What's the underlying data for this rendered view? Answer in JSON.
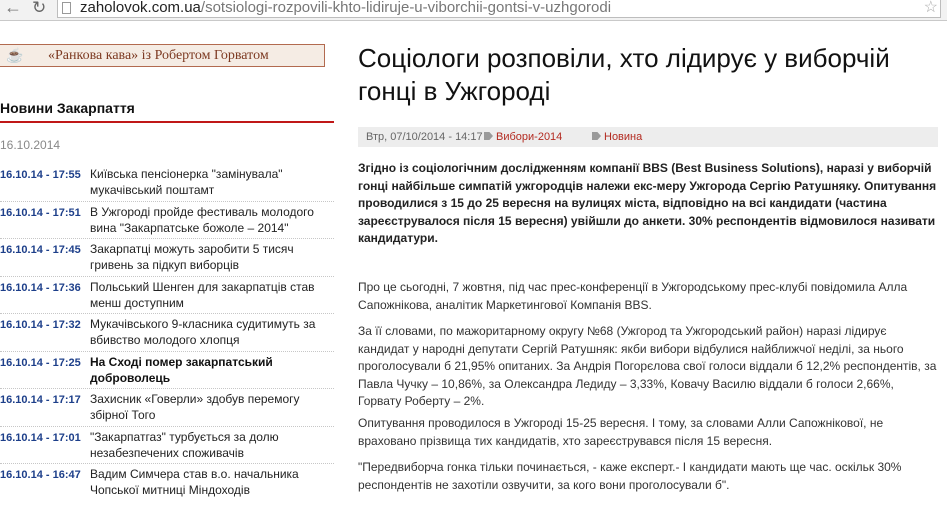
{
  "browser": {
    "url_host": "zaholovok.com.ua",
    "url_path": "/sotsiologi-rozpovili-khto-lidiruje-u-viborchii-gontsi-v-uzhgorodi"
  },
  "promo": {
    "label": "«Ранкова кава» із Робертом Горватом"
  },
  "news": {
    "heading": "Новини Закарпаття",
    "date": "16.10.2014",
    "items": [
      {
        "time": "16.10.14 - 17:55",
        "title": "Київська пенсіонерка \"замінувала\" мукачівський поштамт"
      },
      {
        "time": "16.10.14 - 17:51",
        "title": "В Ужгороді пройде фестиваль молодого вина \"Закарпатське божоле – 2014\""
      },
      {
        "time": "16.10.14 - 17:45",
        "title": "Закарпатці можуть заробити 5 тисяч гривень за підкуп виборців"
      },
      {
        "time": "16.10.14 - 17:36",
        "title": "Польський Шенген для закарпатців став менш доступним"
      },
      {
        "time": "16.10.14 - 17:32",
        "title": "Мукачівського 9-класника судитимуть за вбивство молодого хлопця"
      },
      {
        "time": "16.10.14 - 17:25",
        "title": "На Сході помер закарпатський доброволець"
      },
      {
        "time": "16.10.14 - 17:17",
        "title": "Захисник «Говерли» здобув перемогу збірної Того"
      },
      {
        "time": "16.10.14 - 17:01",
        "title": "\"Закарпатгаз\" турбується за долю незабезпечених споживачів"
      },
      {
        "time": "16.10.14 - 16:47",
        "title": "Вадим Симчера став в.о. начальника Чопської митниці Міндоходів"
      }
    ]
  },
  "article": {
    "title": "Соціологи розповіли, хто лідирує у виборчій гонці в Ужгороді",
    "date": "Втр, 07/10/2014 - 14:17",
    "tags": [
      "Вибори-2014",
      "Новина"
    ],
    "lead": "Згідно із соціологічним дослідженням компанії  BBS (Best Business Solutions), наразі у виборчій гонці найбільше симпатій ужгородців належи екс-меру Ужгорода Сергію Ратушняку. Опитування проводилися з 15 до 25 вересня на вулицях міста, відповідно на всі кандидати (частина зареєструвалося після 15 вересня) увійшли до анкети. 30% респондентів відмовилося називати кандидатури.",
    "paragraphs": [
      "Про це сьогодні, 7 жовтня, під час прес-конференції в Ужгородському прес-клубі повідомила  Алла Сапожнікова, аналітик Маркетингової Компанія BBS.",
      "За її словами, по мажоритарному округу №68 (Ужгород та Ужгородський район) наразі лідирує кандидат у народні депутати Сергій Ратушняк: якби вибори відбулися найближчої неділі, за нього проголосували б 21,95% опитаних. За Андрія Погорєлова свої голоси віддали б 12,2% респондентів, за Павла Чучку – 10,86%, за Олександра Ледиду – 3,33%, Ковачу Василю віддали б голоси 2,66%, Горвату Роберту – 2%.",
      "Опитування проводилося в Ужгороді 15-25 вересня. І тому, за словами Алли Сапожнікової, не враховано прізвища тих кандидатів, хто зареєструвався після 15 вересня.",
      "\"Передвиборча гонка тільки починається, - каже експерт.- І кандидати мають ще час. оскільк 30% респондентів не захотіли озвучити, за кого вони проголосували б\"."
    ]
  }
}
